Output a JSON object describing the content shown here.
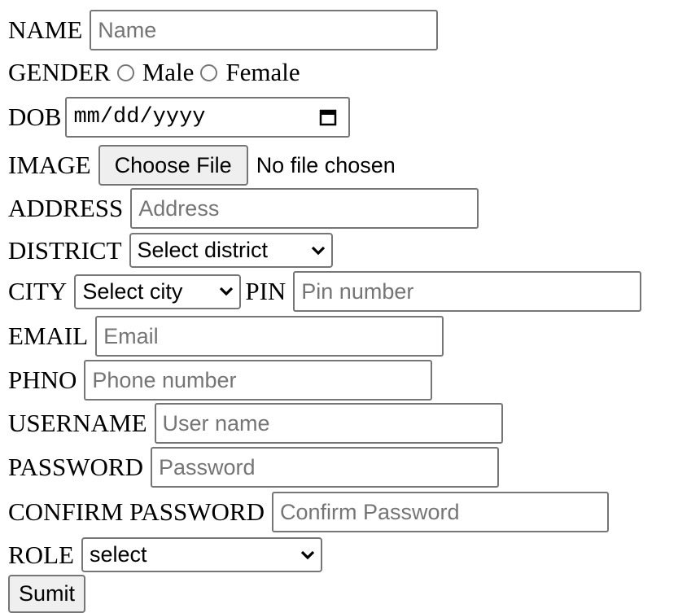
{
  "form": {
    "name_label": "NAME",
    "name_placeholder": "Name",
    "gender_label": "GENDER",
    "gender_male": "Male",
    "gender_female": "Female",
    "dob_label": "DOB",
    "dob_placeholder": "mm/dd/yyyy",
    "image_label": "IMAGE",
    "choose_file": "Choose File",
    "no_file": "No file chosen",
    "address_label": "ADDRESS",
    "address_placeholder": "Address",
    "district_label": "DISTRICT",
    "district_selected": "Select district",
    "city_label": "CITY",
    "city_selected": "Select city",
    "pin_label": "PIN",
    "pin_placeholder": "Pin number",
    "email_label": "EMAIL",
    "email_placeholder": "Email",
    "phno_label": "PHNO",
    "phno_placeholder": "Phone number",
    "username_label": "USERNAME",
    "username_placeholder": "User name",
    "password_label": "PASSWORD",
    "password_placeholder": "Password",
    "confirm_label": "CONFIRM PASSWORD",
    "confirm_placeholder": "Confirm Password",
    "role_label": "ROLE",
    "role_selected": "select",
    "submit_label": "Sumit"
  },
  "icons": {
    "calendar": "calendar-icon",
    "chevron": "chevron-down-icon"
  }
}
